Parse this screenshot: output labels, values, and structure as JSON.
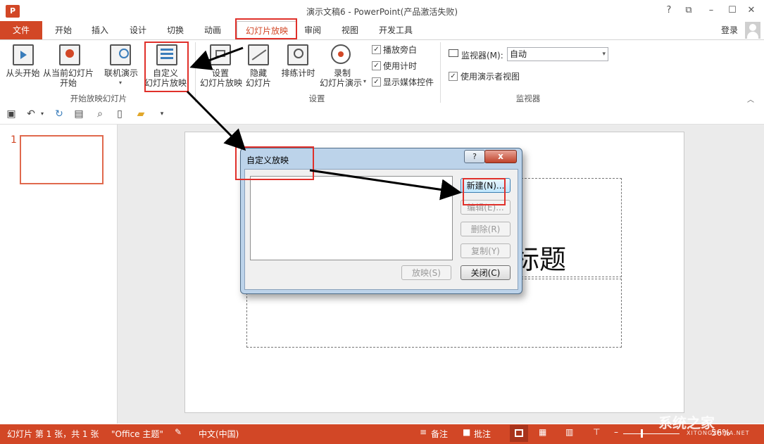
{
  "window": {
    "title": "演示文稿6 - PowerPoint(产品激活失败)",
    "app_icon": "P",
    "controls": [
      "?",
      "⧉",
      "–",
      "☐",
      "✕"
    ]
  },
  "tabs": [
    "文件",
    "开始",
    "插入",
    "设计",
    "切换",
    "动画",
    "幻灯片放映",
    "审阅",
    "视图",
    "开发工具"
  ],
  "active_tab": "幻灯片放映",
  "account": {
    "login": "登录"
  },
  "ribbon": {
    "start_group": {
      "label": "开始放映幻灯片",
      "from_beginning": "从头开始",
      "from_current_1": "从当前幻灯片",
      "from_current_2": "开始",
      "online": "联机演示",
      "custom_1": "自定义",
      "custom_2": "幻灯片放映"
    },
    "setup_group": {
      "label": "设置",
      "setup_1": "设置",
      "setup_2": "幻灯片放映",
      "hide_1": "隐藏",
      "hide_2": "幻灯片",
      "rehearse": "排练计时",
      "record_1": "录制",
      "record_2": "幻灯片演示",
      "chk_narration": "播放旁白",
      "chk_timings": "使用计时",
      "chk_media": "显示媒体控件"
    },
    "monitor_group": {
      "label": "监视器",
      "monitor_label": "监视器(M):",
      "monitor_value": "自动",
      "presenter_view": "使用演示者视图"
    }
  },
  "thumbnail": {
    "number": "1"
  },
  "slide": {
    "title_fragment": "标题"
  },
  "dialog": {
    "title": "自定义放映",
    "help": "?",
    "close_x": "x",
    "btn_new": "新建(N)...",
    "btn_edit": "编辑(E)...",
    "btn_delete": "删除(R)",
    "btn_copy": "复制(Y)",
    "btn_show": "放映(S)",
    "btn_close": "关闭(C)"
  },
  "status": {
    "slide_info": "幻灯片 第 1 张，共 1 张",
    "theme": "\"Office 主题\"",
    "language": "中文(中国)",
    "notes": "备注",
    "comments": "批注",
    "zoom": "56%"
  },
  "watermark": {
    "text": "系统之家",
    "sub": "XITONGZHIJIA.NET"
  },
  "colors": {
    "accent": "#d24726",
    "annotation": "#e0302a",
    "arrow": "#000000"
  }
}
